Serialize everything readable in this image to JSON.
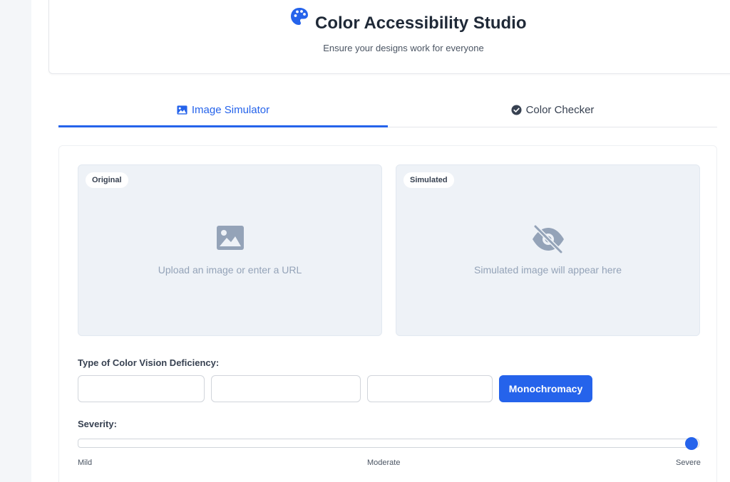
{
  "header": {
    "title": "Color Accessibility Studio",
    "subtitle": "Ensure your designs work for everyone",
    "icon": "palette-icon"
  },
  "tabs": [
    {
      "label": "Image Simulator",
      "icon": "image-icon",
      "active": true
    },
    {
      "label": "Color Checker",
      "icon": "check-circle-icon",
      "active": false
    }
  ],
  "original": {
    "badge": "Original",
    "placeholder": "Upload an image or enter a URL",
    "icon": "image-icon"
  },
  "simulated": {
    "badge": "Simulated",
    "placeholder": "Simulated image will appear here",
    "icon": "eye-slash-icon"
  },
  "deficiency": {
    "label": "Type of Color Vision Deficiency:",
    "options": [
      "",
      "",
      "",
      "Monochromacy"
    ],
    "selected": "Monochromacy"
  },
  "severity": {
    "label": "Severity:",
    "value": 1.0,
    "scale": [
      "Mild",
      "Moderate",
      "Severe"
    ]
  },
  "colors": {
    "accent": "#2563eb",
    "muted_text": "#94a3b8",
    "placeholder_bg": "#eef2f7"
  }
}
